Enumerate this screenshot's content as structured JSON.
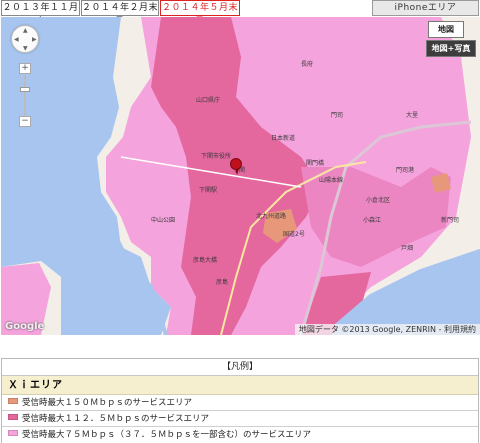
{
  "tabs": [
    {
      "label": "２０１３年１１月末",
      "active": false
    },
    {
      "label": "２０１４年２月末予",
      "active": false
    },
    {
      "label": "２０１４年５月末予",
      "active": true
    }
  ],
  "iphone_tab": "iPhoneエリア",
  "map": {
    "type_buttons": [
      "地図",
      "地図+写真"
    ],
    "google_logo": "Google",
    "attribution": "地図データ ©2013 Google, ZENRIN - 利用規約",
    "pan_arrows": [
      "▲",
      "◀",
      "▶",
      "▼"
    ],
    "zoom_in": "+",
    "zoom_out": "−",
    "labels": [
      "山口県庁",
      "下関市役所",
      "門司港",
      "彦島",
      "関門橋",
      "下関駅",
      "山陽本線",
      "小倉北区",
      "日本新道",
      "中山公園",
      "国道2号",
      "下関",
      "彦島大橋",
      "北九州道路",
      "戸畑",
      "門司",
      "小森江",
      "大里",
      "新門司",
      "長府"
    ]
  },
  "colors": {
    "coverage_150": "#e8987a",
    "coverage_112": "#e4679e",
    "coverage_75": "#f5a3dd",
    "active_tab": "#dd2222",
    "legend_header_bg": "#f5efcf",
    "sea": "#a7c5ef"
  },
  "legend": {
    "title": "【凡例】",
    "section": "Ｘｉエリア",
    "items": [
      {
        "label": "受信時最大１５０Ｍｂｐｓのサービスエリア",
        "color": "#e8987a"
      },
      {
        "label": "受信時最大１１２．５Ｍｂｐｓのサービスエリア",
        "color": "#e4679e"
      },
      {
        "label": "受信時最大７５Ｍｂｐｓ（３７．５Ｍｂｐｓを一部含む）のサービスエリア",
        "color": "#f5a3dd"
      }
    ]
  }
}
